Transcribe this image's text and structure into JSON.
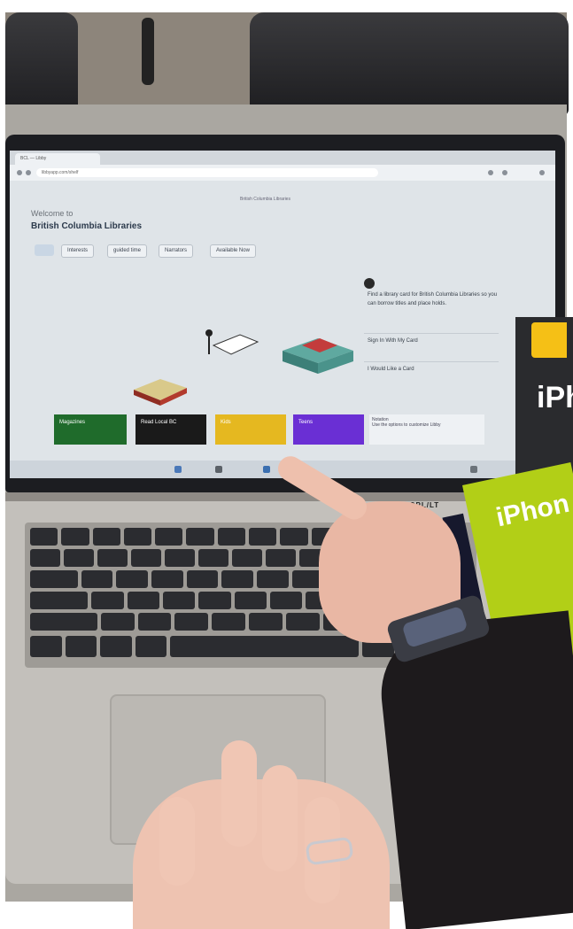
{
  "browser": {
    "tab_title": "BCL — Libby",
    "address": "libbyapp.com/shelf"
  },
  "page": {
    "top_label": "British Columbia Libraries",
    "welcome": "Welcome to",
    "library_name": "British Columbia Libraries",
    "filters": [
      "Interests",
      "guided time",
      "Narrators",
      "Available Now"
    ]
  },
  "side_panel": {
    "intro": "Find a library card for British Columbia Libraries so you can borrow titles and place holds.",
    "option_sign_in": "Sign In With My Card",
    "option_get_card": "I Would Like a Card"
  },
  "tiles": [
    {
      "label": "Magazines",
      "color": "#1f6b2b"
    },
    {
      "label": "Read Local BC",
      "color": "#1a1a1a"
    },
    {
      "label": "Kids",
      "color": "#e5b820"
    },
    {
      "label": "Teens",
      "color": "#6a2fd4"
    }
  ],
  "info_box": {
    "title": "Notation",
    "text": "Use the options to customize Libby"
  },
  "props": {
    "book_green_title": "iPhon",
    "book_dark_title": "iPho",
    "label_strip": "PGPL/LT"
  },
  "colors": {
    "screen_bg": "#dfe4e8",
    "laptop_body": "#c3c0bb",
    "book_green": "#b2cf17",
    "sleeve": "#1d1a1c"
  }
}
